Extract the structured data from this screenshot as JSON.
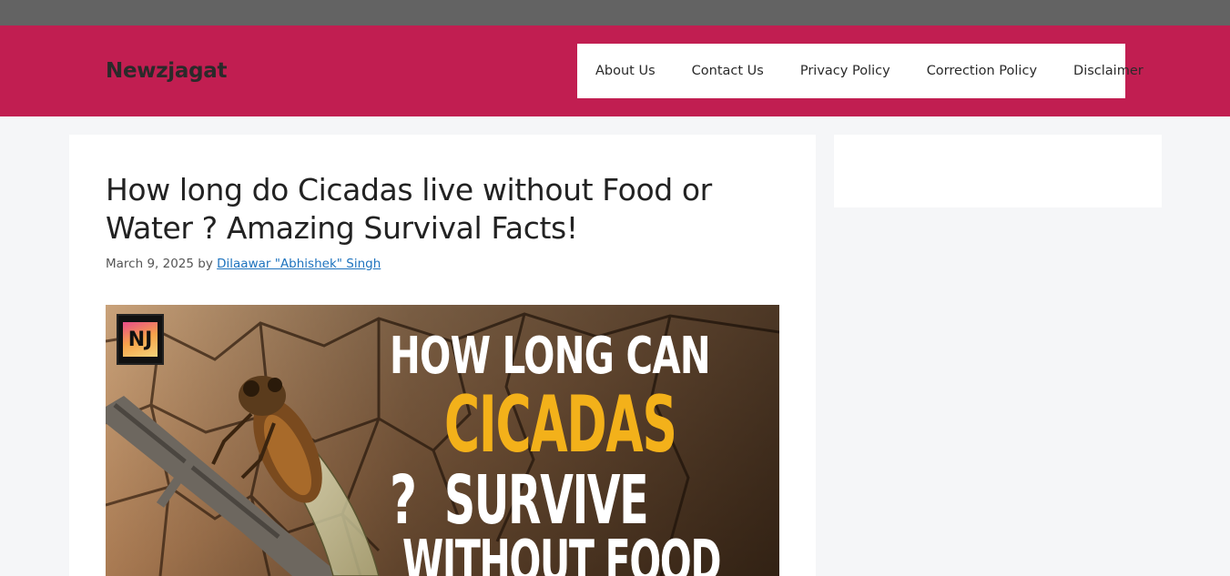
{
  "site": {
    "title": "Newzjagat"
  },
  "nav": {
    "items": [
      {
        "label": "About Us"
      },
      {
        "label": "Contact Us"
      },
      {
        "label": "Privacy Policy"
      },
      {
        "label": "Correction Policy"
      },
      {
        "label": "Disclaimer"
      }
    ]
  },
  "article": {
    "title": "How long do Cicadas live without Food or Water ? Amazing Survival Facts!",
    "date": "March 9, 2025",
    "by": "by",
    "author": "Dilaawar \"Abhishek\" Singh",
    "hero_image": {
      "logo_text": "NJ",
      "line1": "HOW LONG CAN",
      "line2": "CICADAS",
      "line3_mark": "?",
      "line3": "SURVIVE",
      "line4": "WITHOUT FOOD"
    }
  },
  "colors": {
    "header": "#c11e51",
    "topbar": "#636363",
    "link": "#1e73be",
    "accent_text": "#f3b11a"
  }
}
